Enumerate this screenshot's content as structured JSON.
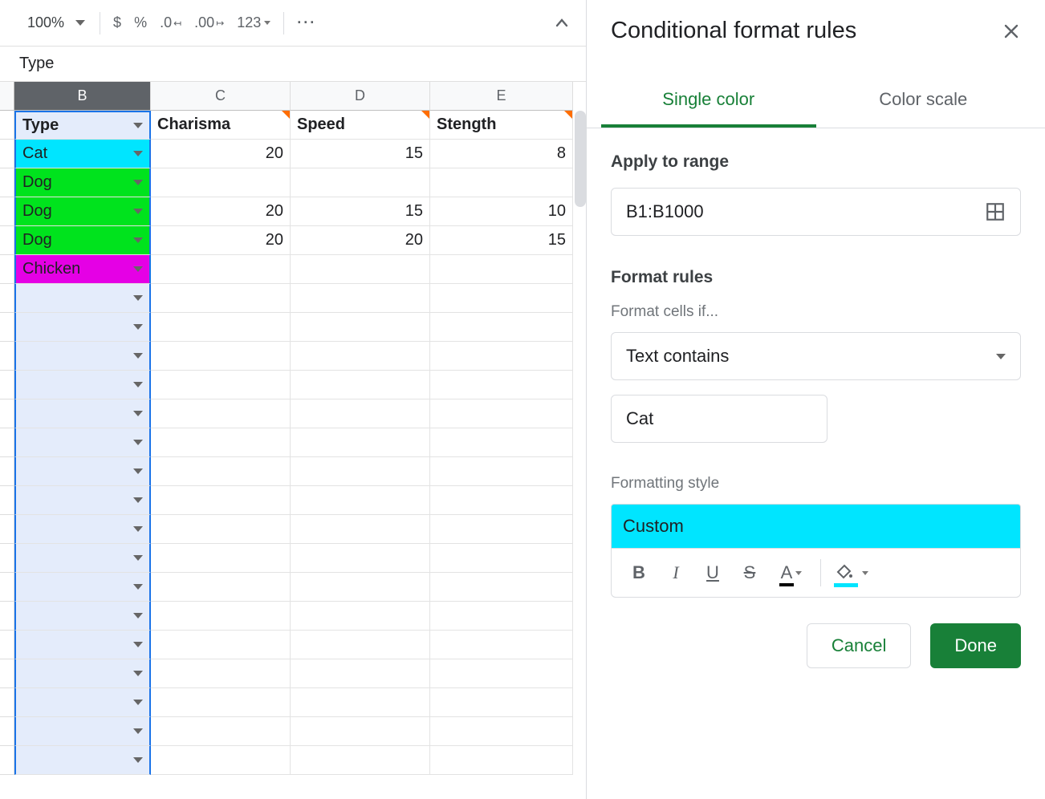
{
  "toolbar": {
    "zoom": "100%",
    "currency": "$",
    "percent": "%",
    "dec_dec": ".0",
    "inc_dec": ".00",
    "num_fmt": "123",
    "more": "···"
  },
  "formula_bar": "Type",
  "columns": [
    "B",
    "C",
    "D",
    "E"
  ],
  "header_row": {
    "B": "Type",
    "C": "Charisma",
    "D": "Speed",
    "E": "Stength"
  },
  "rows": [
    {
      "B": "Cat",
      "C": "20",
      "D": "15",
      "E": "8",
      "bcolor": "#00e5ff"
    },
    {
      "B": "Dog",
      "C": "",
      "D": "",
      "E": "",
      "bcolor": "#00e31d"
    },
    {
      "B": "Dog",
      "C": "20",
      "D": "15",
      "E": "10",
      "bcolor": "#00e31d"
    },
    {
      "B": "Dog",
      "C": "20",
      "D": "20",
      "E": "15",
      "bcolor": "#00e31d"
    },
    {
      "B": "Chicken",
      "C": "",
      "D": "",
      "E": "",
      "bcolor": "#e500e5"
    }
  ],
  "empty_row_count": 17,
  "sidebar": {
    "title": "Conditional format rules",
    "tabs": {
      "single": "Single color",
      "scale": "Color scale"
    },
    "apply_label": "Apply to range",
    "range_value": "B1:B1000",
    "rules_label": "Format rules",
    "cells_if_label": "Format cells if...",
    "condition": "Text contains",
    "condition_value": "Cat",
    "style_label": "Formatting style",
    "style_preview_text": "Custom",
    "style_preview_bg": "#00e5ff",
    "cancel": "Cancel",
    "done": "Done"
  }
}
